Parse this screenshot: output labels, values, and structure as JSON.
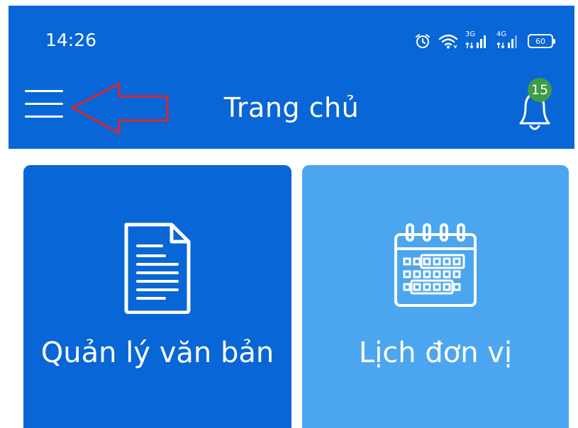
{
  "status_bar": {
    "time": "14:26",
    "network_1": "3G",
    "network_2": "4G",
    "battery": "60"
  },
  "app_bar": {
    "title": "Trang chủ",
    "notification_count": "15",
    "menu_icon": "hamburger-menu-icon",
    "notification_icon": "bell-icon"
  },
  "annotation": {
    "arrow_color": "#d9262c"
  },
  "tiles": [
    {
      "label": "Quản lý văn bản",
      "icon": "document-icon",
      "color": "#0866d6"
    },
    {
      "label": "Lịch đơn vị",
      "icon": "calendar-icon",
      "color": "#4ba6ef"
    }
  ],
  "colors": {
    "primary": "#0866d6",
    "secondary": "#4ba6ef",
    "badge": "#3f9b47"
  }
}
